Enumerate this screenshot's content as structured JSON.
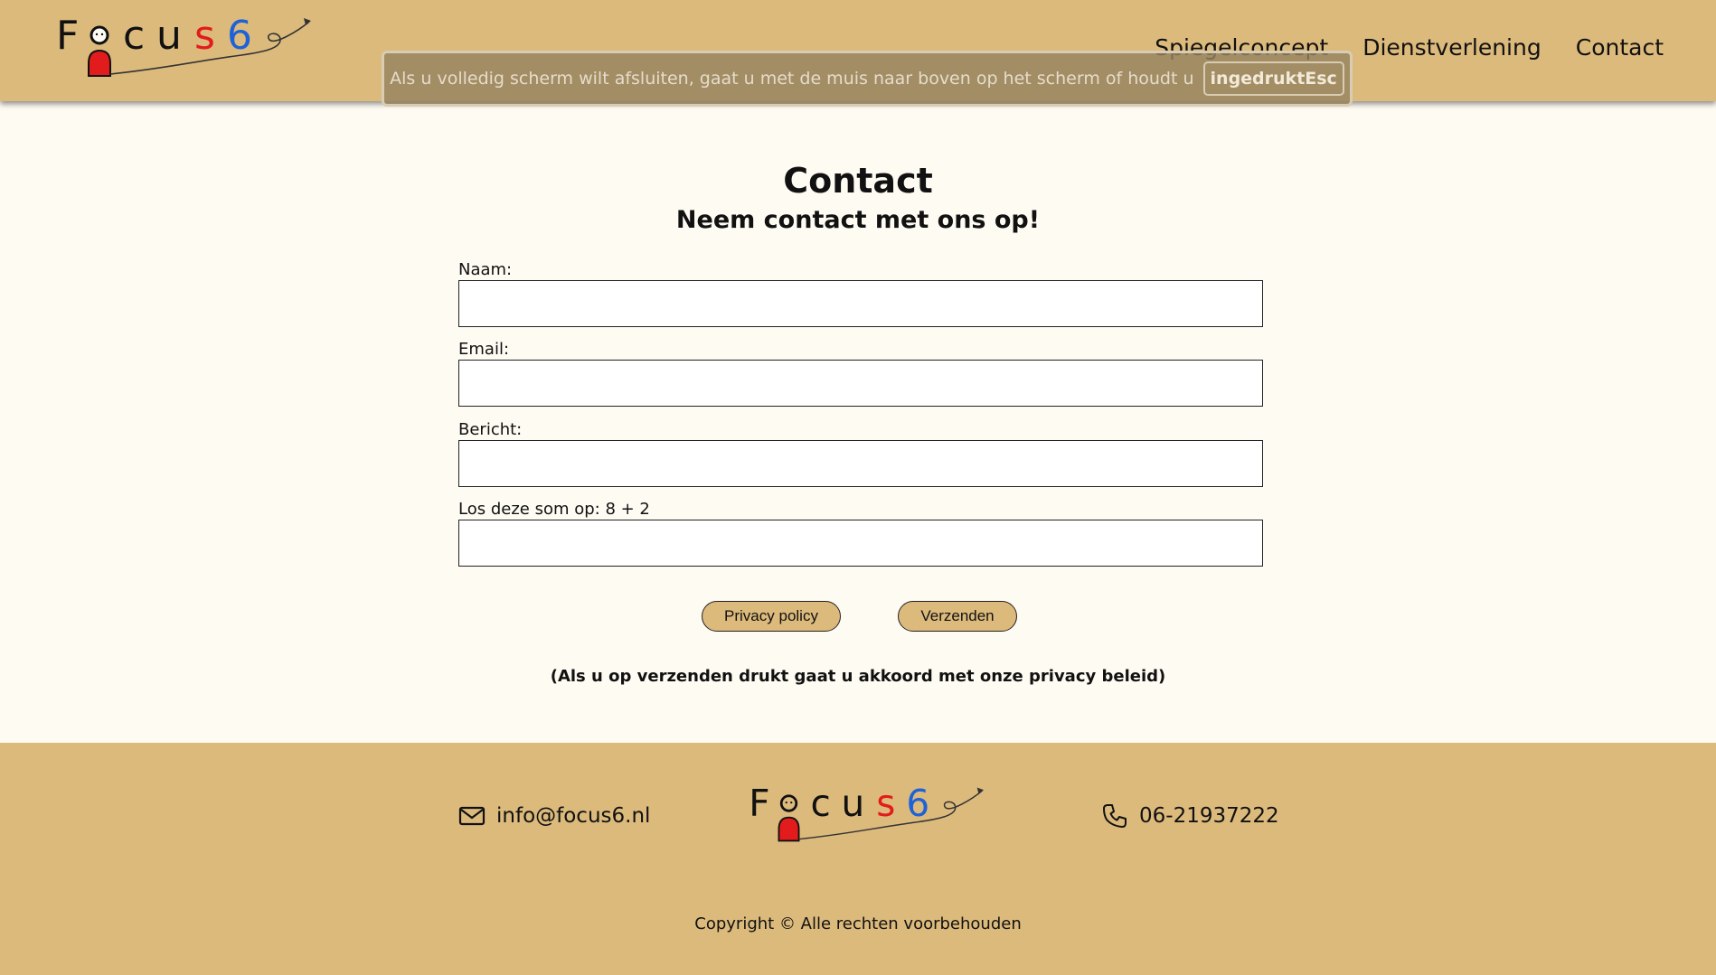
{
  "brand": {
    "logo_letters": [
      "F",
      "o",
      "c",
      "u",
      "s",
      "6"
    ],
    "colors": {
      "header_bg": "#dcba7c",
      "page_bg": "#fefbf3",
      "logo_dark": "#111111",
      "logo_red": "#e21c1c",
      "logo_blue": "#1e62d8"
    }
  },
  "nav": {
    "items": [
      {
        "label": "Spiegelconcept"
      },
      {
        "label": "Dienstverlening"
      },
      {
        "label": "Contact"
      }
    ]
  },
  "fullscreen_notice": {
    "text": "Als u volledig scherm wilt afsluiten, gaat u met de muis naar boven op het scherm of houdt u",
    "key_label": "ingedruktEsc"
  },
  "form": {
    "title": "Contact",
    "subtitle": "Neem contact met ons op!",
    "fields": [
      {
        "label": "Naam:",
        "value": ""
      },
      {
        "label": "Email:",
        "value": ""
      },
      {
        "label": "Bericht:",
        "value": ""
      },
      {
        "label": "Los deze som op: 8 + 2",
        "value": ""
      }
    ],
    "privacy_button": "Privacy policy",
    "submit_button": "Verzenden",
    "consent_text": "(Als u op verzenden drukt gaat u akkoord met onze privacy beleid)"
  },
  "footer": {
    "email": "info@focus6.nl",
    "email_icon": "envelope-icon",
    "phone": "06-21937222",
    "phone_icon": "phone-icon",
    "copyright": "Copyright © Alle rechten voorbehouden"
  }
}
